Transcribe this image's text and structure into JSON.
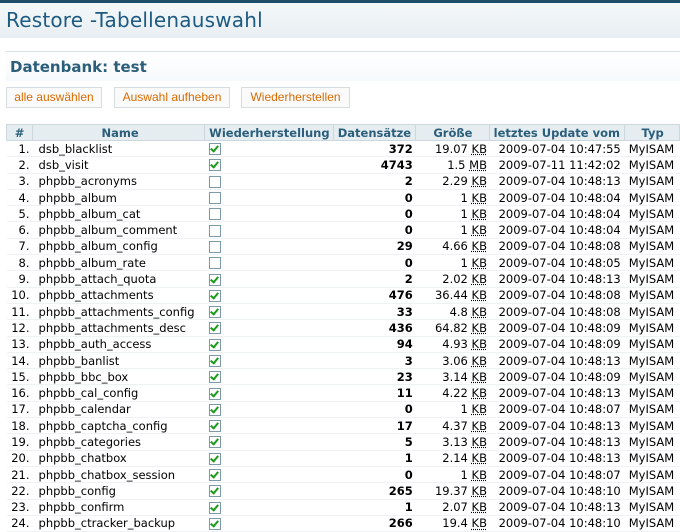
{
  "page": {
    "title": "Restore -Tabellenauswahl"
  },
  "database": {
    "label": "Datenbank: test"
  },
  "buttons": {
    "select_all": "alle auswählen",
    "deselect": "Auswahl aufheben",
    "restore": "Wiederherstellen"
  },
  "table": {
    "headers": {
      "num": "#",
      "name": "Name",
      "restore": "Wiederherstellung",
      "records": "Datensätze",
      "size": "Größe",
      "updated": "letztes Update vom",
      "type": "Typ"
    },
    "rows": [
      {
        "num": "1.",
        "name": "dsb_blacklist",
        "checked": true,
        "records": "372",
        "size": "19.07",
        "unit": "KB",
        "updated": "2009-07-04 10:47:55",
        "type": "MyISAM"
      },
      {
        "num": "2.",
        "name": "dsb_visit",
        "checked": true,
        "records": "4743",
        "size": "1.5",
        "unit": "MB",
        "updated": "2009-07-11 11:42:02",
        "type": "MyISAM"
      },
      {
        "num": "3.",
        "name": "phpbb_acronyms",
        "checked": false,
        "records": "2",
        "size": "2.29",
        "unit": "KB",
        "updated": "2009-07-04 10:48:13",
        "type": "MyISAM"
      },
      {
        "num": "4.",
        "name": "phpbb_album",
        "checked": false,
        "records": "0",
        "size": "1",
        "unit": "KB",
        "updated": "2009-07-04 10:48:04",
        "type": "MyISAM"
      },
      {
        "num": "5.",
        "name": "phpbb_album_cat",
        "checked": false,
        "records": "0",
        "size": "1",
        "unit": "KB",
        "updated": "2009-07-04 10:48:04",
        "type": "MyISAM"
      },
      {
        "num": "6.",
        "name": "phpbb_album_comment",
        "checked": false,
        "records": "0",
        "size": "1",
        "unit": "KB",
        "updated": "2009-07-04 10:48:04",
        "type": "MyISAM"
      },
      {
        "num": "7.",
        "name": "phpbb_album_config",
        "checked": false,
        "records": "29",
        "size": "4.66",
        "unit": "KB",
        "updated": "2009-07-04 10:48:08",
        "type": "MyISAM"
      },
      {
        "num": "8.",
        "name": "phpbb_album_rate",
        "checked": false,
        "records": "0",
        "size": "1",
        "unit": "KB",
        "updated": "2009-07-04 10:48:05",
        "type": "MyISAM"
      },
      {
        "num": "9.",
        "name": "phpbb_attach_quota",
        "checked": true,
        "records": "2",
        "size": "2.02",
        "unit": "KB",
        "updated": "2009-07-04 10:48:13",
        "type": "MyISAM"
      },
      {
        "num": "10.",
        "name": "phpbb_attachments",
        "checked": true,
        "records": "476",
        "size": "36.44",
        "unit": "KB",
        "updated": "2009-07-04 10:48:08",
        "type": "MyISAM"
      },
      {
        "num": "11.",
        "name": "phpbb_attachments_config",
        "checked": true,
        "records": "33",
        "size": "4.8",
        "unit": "KB",
        "updated": "2009-07-04 10:48:08",
        "type": "MyISAM"
      },
      {
        "num": "12.",
        "name": "phpbb_attachments_desc",
        "checked": true,
        "records": "436",
        "size": "64.82",
        "unit": "KB",
        "updated": "2009-07-04 10:48:09",
        "type": "MyISAM"
      },
      {
        "num": "13.",
        "name": "phpbb_auth_access",
        "checked": true,
        "records": "94",
        "size": "4.93",
        "unit": "KB",
        "updated": "2009-07-04 10:48:09",
        "type": "MyISAM"
      },
      {
        "num": "14.",
        "name": "phpbb_banlist",
        "checked": true,
        "records": "3",
        "size": "3.06",
        "unit": "KB",
        "updated": "2009-07-04 10:48:13",
        "type": "MyISAM"
      },
      {
        "num": "15.",
        "name": "phpbb_bbc_box",
        "checked": true,
        "records": "23",
        "size": "3.14",
        "unit": "KB",
        "updated": "2009-07-04 10:48:09",
        "type": "MyISAM"
      },
      {
        "num": "16.",
        "name": "phpbb_cal_config",
        "checked": true,
        "records": "11",
        "size": "4.22",
        "unit": "KB",
        "updated": "2009-07-04 10:48:13",
        "type": "MyISAM"
      },
      {
        "num": "17.",
        "name": "phpbb_calendar",
        "checked": true,
        "records": "0",
        "size": "1",
        "unit": "KB",
        "updated": "2009-07-04 10:48:07",
        "type": "MyISAM"
      },
      {
        "num": "18.",
        "name": "phpbb_captcha_config",
        "checked": true,
        "records": "17",
        "size": "4.37",
        "unit": "KB",
        "updated": "2009-07-04 10:48:13",
        "type": "MyISAM"
      },
      {
        "num": "19.",
        "name": "phpbb_categories",
        "checked": true,
        "records": "5",
        "size": "3.13",
        "unit": "KB",
        "updated": "2009-07-04 10:48:13",
        "type": "MyISAM"
      },
      {
        "num": "20.",
        "name": "phpbb_chatbox",
        "checked": true,
        "records": "1",
        "size": "2.14",
        "unit": "KB",
        "updated": "2009-07-04 10:48:13",
        "type": "MyISAM"
      },
      {
        "num": "21.",
        "name": "phpbb_chatbox_session",
        "checked": true,
        "records": "0",
        "size": "1",
        "unit": "KB",
        "updated": "2009-07-04 10:48:07",
        "type": "MyISAM"
      },
      {
        "num": "22.",
        "name": "phpbb_config",
        "checked": true,
        "records": "265",
        "size": "19.37",
        "unit": "KB",
        "updated": "2009-07-04 10:48:10",
        "type": "MyISAM"
      },
      {
        "num": "23.",
        "name": "phpbb_confirm",
        "checked": true,
        "records": "1",
        "size": "2.07",
        "unit": "KB",
        "updated": "2009-07-04 10:48:13",
        "type": "MyISAM"
      },
      {
        "num": "24.",
        "name": "phpbb_ctracker_backup",
        "checked": true,
        "records": "266",
        "size": "19.4",
        "unit": "KB",
        "updated": "2009-07-04 10:48:10",
        "type": "MyISAM"
      }
    ]
  },
  "colors": {
    "title": "#1d5a82",
    "button_text": "#d96b00",
    "header_bg": "#e6edf1",
    "check": "#1a9a1a"
  }
}
